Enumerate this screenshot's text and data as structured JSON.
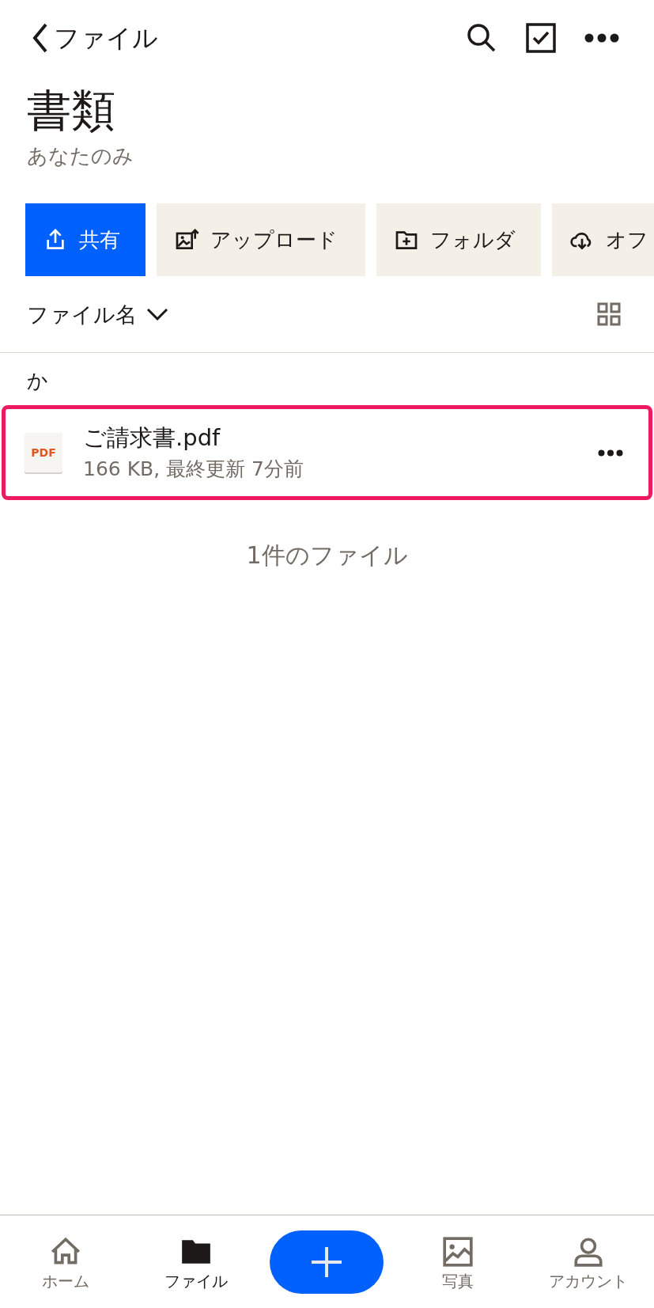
{
  "header": {
    "back_label": "ファイル"
  },
  "title": "書類",
  "subtitle": "あなたのみ",
  "actions": [
    {
      "label": "共有",
      "kind": "primary"
    },
    {
      "label": "アップロード",
      "kind": "secondary"
    },
    {
      "label": "フォルダ",
      "kind": "secondary"
    },
    {
      "label": "オフ",
      "kind": "secondary"
    }
  ],
  "sort": {
    "label": "ファイル名"
  },
  "section": "か",
  "files": [
    {
      "name": "ご請求書.pdf",
      "meta": "166 KB, 最終更新 7分前",
      "type": "PDF",
      "highlighted": true
    }
  ],
  "footer_count": "1件のファイル",
  "tabs": [
    {
      "label": "ホーム",
      "selected": false
    },
    {
      "label": "ファイル",
      "selected": true
    },
    {
      "kind": "add"
    },
    {
      "label": "写真",
      "selected": false
    },
    {
      "label": "アカウント",
      "selected": false
    }
  ]
}
